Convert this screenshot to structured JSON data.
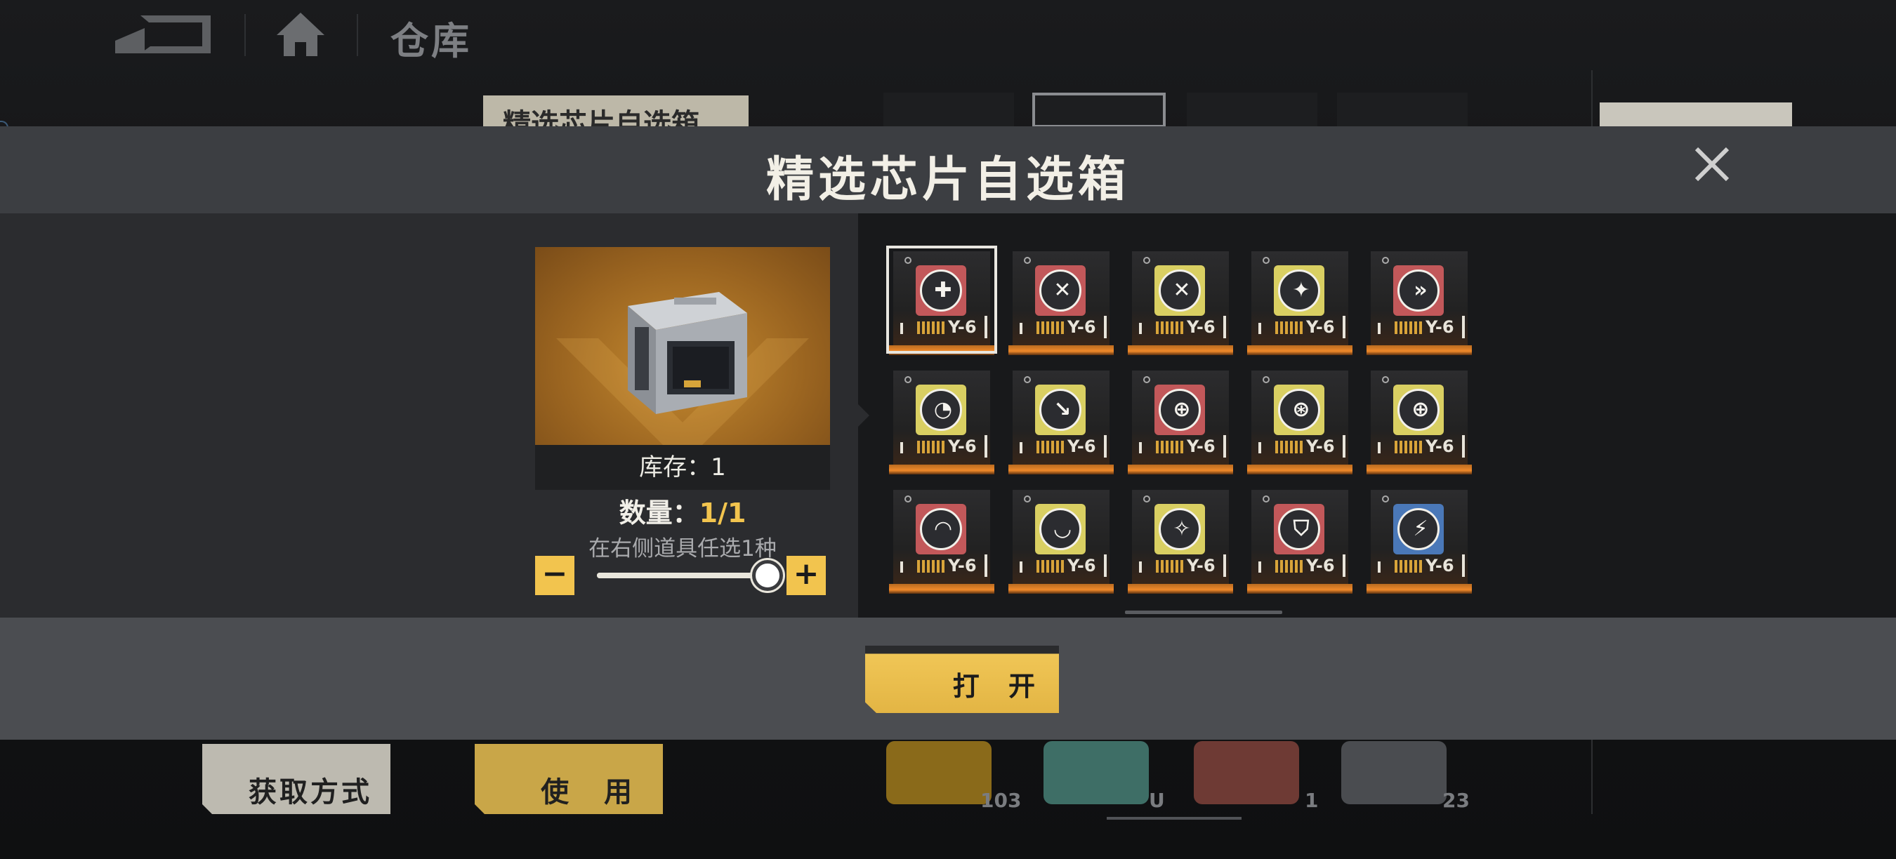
{
  "topbar": {
    "page_title": "仓库"
  },
  "background": {
    "selected_item_label": "精选芯片自选箱",
    "buttons": {
      "get_method": "获取方式",
      "use": "使 用"
    },
    "item_counts": [
      "103",
      "U",
      "1",
      "23"
    ]
  },
  "dialog": {
    "title": "精选芯片自选箱",
    "stock_label": "库存：",
    "stock_value": "1",
    "quantity_label": "数量：",
    "quantity_value": "1/1",
    "hint": "在右侧道具任选1种",
    "minus_label": "−",
    "plus_label": "+",
    "quantity_slider_fraction": 1.0,
    "open_button": "打 开"
  },
  "chips": [
    {
      "color": "red",
      "symbol": "✚",
      "icon": "wrench-plus-icon",
      "level": "Y-6",
      "selected": true
    },
    {
      "color": "red",
      "symbol": "✕",
      "icon": "crossed-tools-icon",
      "level": "Y-6",
      "selected": false
    },
    {
      "color": "yellow",
      "symbol": "✕",
      "icon": "crossed-swords-icon",
      "level": "Y-6",
      "selected": false
    },
    {
      "color": "yellow",
      "symbol": "✦",
      "icon": "bullet-spark-icon",
      "level": "Y-6",
      "selected": false
    },
    {
      "color": "red",
      "symbol": "»",
      "icon": "dash-arrows-icon",
      "level": "Y-6",
      "selected": false
    },
    {
      "color": "yellow",
      "symbol": "◔",
      "icon": "swirl-icon",
      "level": "Y-6",
      "selected": false
    },
    {
      "color": "yellow",
      "symbol": "↘",
      "icon": "swoosh-icon",
      "level": "Y-6",
      "selected": false
    },
    {
      "color": "red",
      "symbol": "⊕",
      "icon": "crosshair-icon",
      "level": "Y-6",
      "selected": false
    },
    {
      "color": "yellow",
      "symbol": "⊛",
      "icon": "target-icon",
      "level": "Y-6",
      "selected": false
    },
    {
      "color": "yellow",
      "symbol": "⊕",
      "icon": "aim-icon",
      "level": "Y-6",
      "selected": false
    },
    {
      "color": "red",
      "symbol": "◠",
      "icon": "ripple-icon",
      "level": "Y-6",
      "selected": false
    },
    {
      "color": "yellow",
      "symbol": "◡",
      "icon": "wave-icon",
      "level": "Y-6",
      "selected": false
    },
    {
      "color": "yellow",
      "symbol": "✧",
      "icon": "sparkle-icon",
      "level": "Y-6",
      "selected": false
    },
    {
      "color": "red",
      "symbol": "⛉",
      "icon": "shield-icon",
      "level": "Y-6",
      "selected": false
    },
    {
      "color": "blue",
      "symbol": "⚡",
      "icon": "speed-icon",
      "level": "Y-6",
      "selected": false
    }
  ],
  "colors": {
    "accent": "#f2c44e",
    "chip_red": "#c2585a",
    "chip_yellow": "#d9cf62",
    "chip_blue": "#4a78b8",
    "glow_orange": "#f08a2a"
  }
}
